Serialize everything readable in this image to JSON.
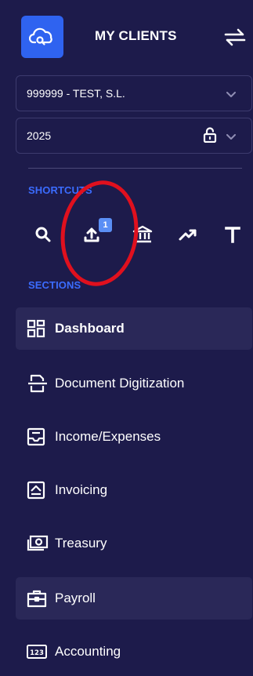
{
  "header": {
    "title": "MY CLIENTS",
    "logo_icon": "cloud-search-icon",
    "swap_icon": "swap-arrows-icon"
  },
  "client_select": {
    "value": "999999 - TEST, S.L."
  },
  "year_select": {
    "value": "2025"
  },
  "shortcuts": {
    "label": "SHORTCUTS",
    "items": [
      {
        "icon": "search-icon"
      },
      {
        "icon": "upload-icon",
        "badge": "1"
      },
      {
        "icon": "bank-icon"
      },
      {
        "icon": "trending-up-icon"
      },
      {
        "icon": "text-icon"
      }
    ]
  },
  "sections": {
    "label": "SECTIONS",
    "items": [
      {
        "label": "Dashboard",
        "icon": "dashboard-icon",
        "state": "active"
      },
      {
        "label": "Document Digitization",
        "icon": "scanner-icon"
      },
      {
        "label": "Income/Expenses",
        "icon": "inbox-icon"
      },
      {
        "label": "Invoicing",
        "icon": "invoice-icon"
      },
      {
        "label": "Treasury",
        "icon": "cash-icon"
      },
      {
        "label": "Payroll",
        "icon": "briefcase-icon",
        "state": "hover"
      },
      {
        "label": "Accounting",
        "icon": "numbers-icon"
      }
    ]
  },
  "colors": {
    "background": "#1d1b4b",
    "accent": "#2f63f0",
    "section_label": "#3b6cff",
    "annotation": "#e0101e"
  }
}
